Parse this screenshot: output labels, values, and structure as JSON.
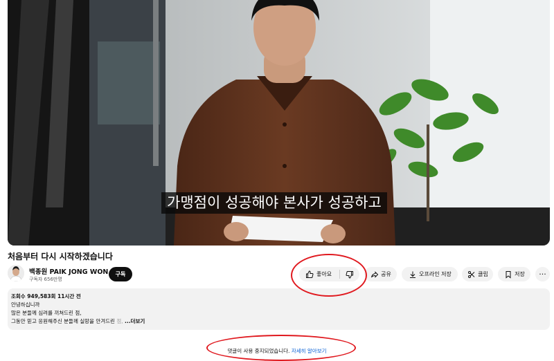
{
  "video": {
    "subtitle": "가맹점이 성공해야 본사가 성공하고"
  },
  "title": "처음부터 다시 시작하겠습니다",
  "channel": {
    "name": "백종원 PAIK JONG WON",
    "subscribers": "구독자 656만명",
    "subscribe_label": "구독"
  },
  "actions": {
    "like_label": "좋아요",
    "share_label": "공유",
    "offline_label": "오프라인 저장",
    "clip_label": "클립",
    "save_label": "저장",
    "more_label": "···"
  },
  "description": {
    "stats": "조회수 949,583회  11시간 전",
    "lines": [
      "안녕하십니까",
      "많은 분들께 심려를 끼쳐드린 점,",
      "그동안 믿고 응원해주신 분들께 실망을 안겨드린 점,"
    ],
    "truncated_tail": "점,",
    "more": "...더보기"
  },
  "comments": {
    "disabled_text": "댓글이 사용 중지되었습니다.",
    "learn_more": "자세히 알아보기"
  },
  "colors": {
    "annotation_ring": "#e0191f",
    "link": "#065fd4"
  }
}
